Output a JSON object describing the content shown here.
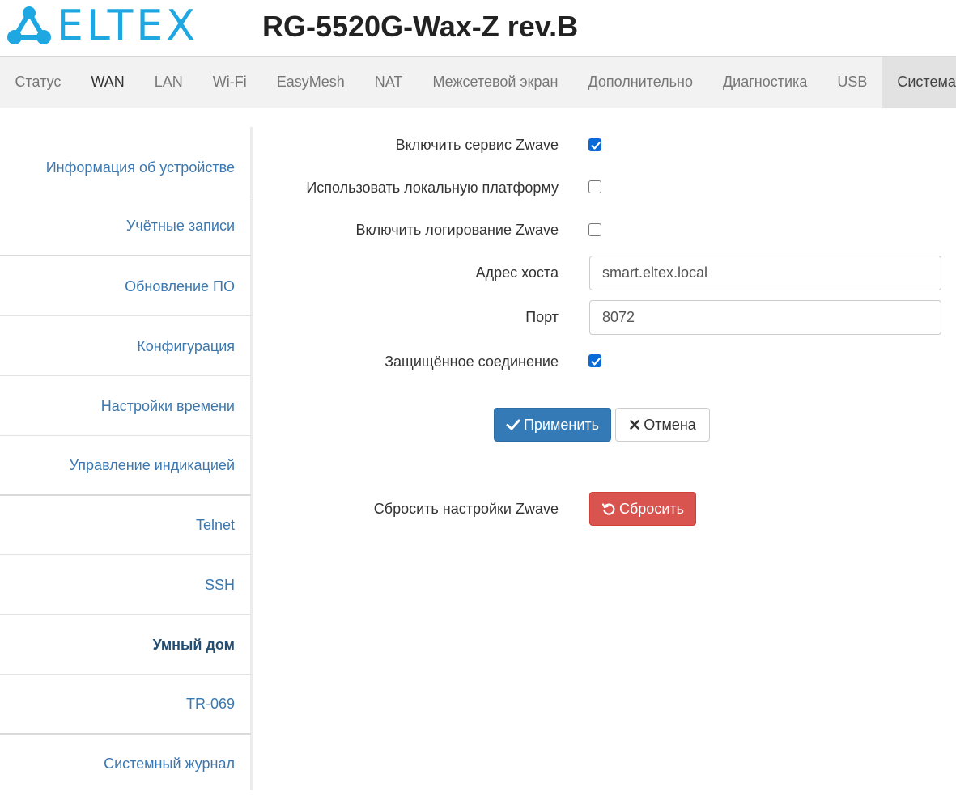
{
  "header": {
    "logo_text": "ELTEX",
    "model": "RG-5520G-Wax-Z rev.B"
  },
  "nav": {
    "tabs": [
      {
        "label": "Статус"
      },
      {
        "label": "WAN"
      },
      {
        "label": "LAN"
      },
      {
        "label": "Wi-Fi"
      },
      {
        "label": "EasyMesh"
      },
      {
        "label": "NAT"
      },
      {
        "label": "Межсетевой экран"
      },
      {
        "label": "Дополнительно"
      },
      {
        "label": "Диагностика"
      },
      {
        "label": "USB"
      },
      {
        "label": "Система"
      }
    ],
    "active_tab": "Система"
  },
  "sidebar": {
    "items": [
      {
        "label": "Информация об устройстве"
      },
      {
        "label": "Учётные записи"
      },
      {
        "label": "Обновление ПО"
      },
      {
        "label": "Конфигурация"
      },
      {
        "label": "Настройки времени"
      },
      {
        "label": "Управление индикацией"
      },
      {
        "label": "Telnet"
      },
      {
        "label": "SSH"
      },
      {
        "label": "Умный дом"
      },
      {
        "label": "TR-069"
      },
      {
        "label": "Системный журнал"
      }
    ],
    "active_item": "Умный дом"
  },
  "form": {
    "enable_zwave": {
      "label": "Включить сервис Zwave",
      "checked": true
    },
    "local_platform": {
      "label": "Использовать локальную платформу",
      "checked": false
    },
    "zwave_logging": {
      "label": "Включить логирование Zwave",
      "checked": false
    },
    "host": {
      "label": "Адрес хоста",
      "value": "smart.eltex.local"
    },
    "port": {
      "label": "Порт",
      "value": "8072"
    },
    "secure": {
      "label": "Защищённое соединение",
      "checked": true
    },
    "apply_label": "Применить",
    "cancel_label": "Отмена",
    "reset_section_label": "Сбросить настройки Zwave",
    "reset_label": "Сбросить"
  },
  "colors": {
    "brand": "#1ea7e1",
    "primary": "#337ab7",
    "danger": "#d9534f",
    "link": "#3b78b0"
  }
}
